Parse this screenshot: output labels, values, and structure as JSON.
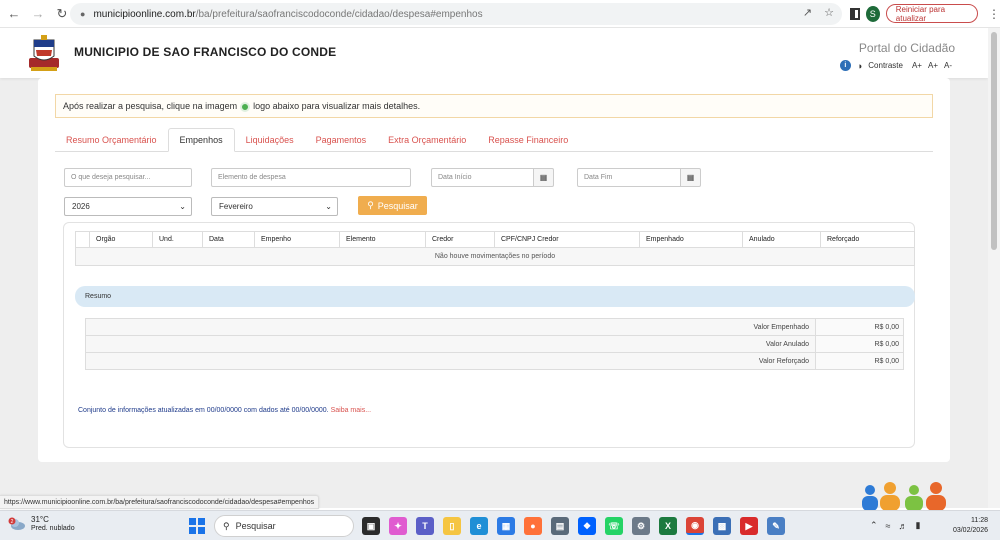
{
  "browser": {
    "url_domain": "municipioonline.com.br",
    "url_path": "/ba/prefeitura/saofranciscodoconde/cidadao/despesa#empenhos",
    "profile_initial": "S",
    "restart_label": "Reiniciar para atualizar"
  },
  "header": {
    "title": "MUNICIPIO DE SAO FRANCISCO DO CONDE",
    "portal": "Portal do Cidadão",
    "info": "i",
    "contrast": "Contraste",
    "font_plus": "A+",
    "font_plus2": "A+",
    "font_minus": "A-"
  },
  "notice": {
    "before": "Após realizar a pesquisa, clique na imagem",
    "after": "logo abaixo para visualizar mais detalhes."
  },
  "tabs": [
    {
      "label": "Resumo Orçamentário",
      "active": false
    },
    {
      "label": "Empenhos",
      "active": true
    },
    {
      "label": "Liquidações",
      "active": false
    },
    {
      "label": "Pagamentos",
      "active": false
    },
    {
      "label": "Extra Orçamentário",
      "active": false
    },
    {
      "label": "Repasse Financeiro",
      "active": false
    }
  ],
  "filters": {
    "search_placeholder": "O que deseja pesquisar...",
    "element_placeholder": "Elemento de despesa",
    "date_start_placeholder": "Data Início",
    "date_end_placeholder": "Data Fim",
    "year": "2026",
    "month": "Fevereiro",
    "search_button": "Pesquisar"
  },
  "table": {
    "columns": [
      "Orgão",
      "Und.",
      "Data",
      "Empenho",
      "Elemento",
      "Credor",
      "CPF/CNPJ Credor",
      "Empenhado",
      "Anulado",
      "Reforçado"
    ],
    "empty_message": "Não houve movimentações no período"
  },
  "summary": {
    "title": "Resumo",
    "rows": [
      {
        "label": "Valor Empenhado",
        "value": "R$ 0,00"
      },
      {
        "label": "Valor Anulado",
        "value": "R$ 0,00"
      },
      {
        "label": "Valor Reforçado",
        "value": "R$ 0,00"
      }
    ]
  },
  "footnote": {
    "text": "Conjunto de informações atualizadas em 00/00/0000 com dados até 00/00/0000.",
    "link": "Saiba mais..."
  },
  "status_url": "https://www.municipioonline.com.br/ba/prefeitura/saofranciscodoconde/cidadao/despesa#empenhos",
  "taskbar": {
    "weather_badge": "2",
    "temperature": "31°C",
    "weather_desc": "Pred. nublado",
    "search_label": "Pesquisar",
    "time": "11:28",
    "date": "03/02/2026"
  },
  "colors": {
    "accent_red": "#d9534f",
    "button_orange": "#f0ad4e",
    "resumo_blue": "#d9e9f5"
  }
}
